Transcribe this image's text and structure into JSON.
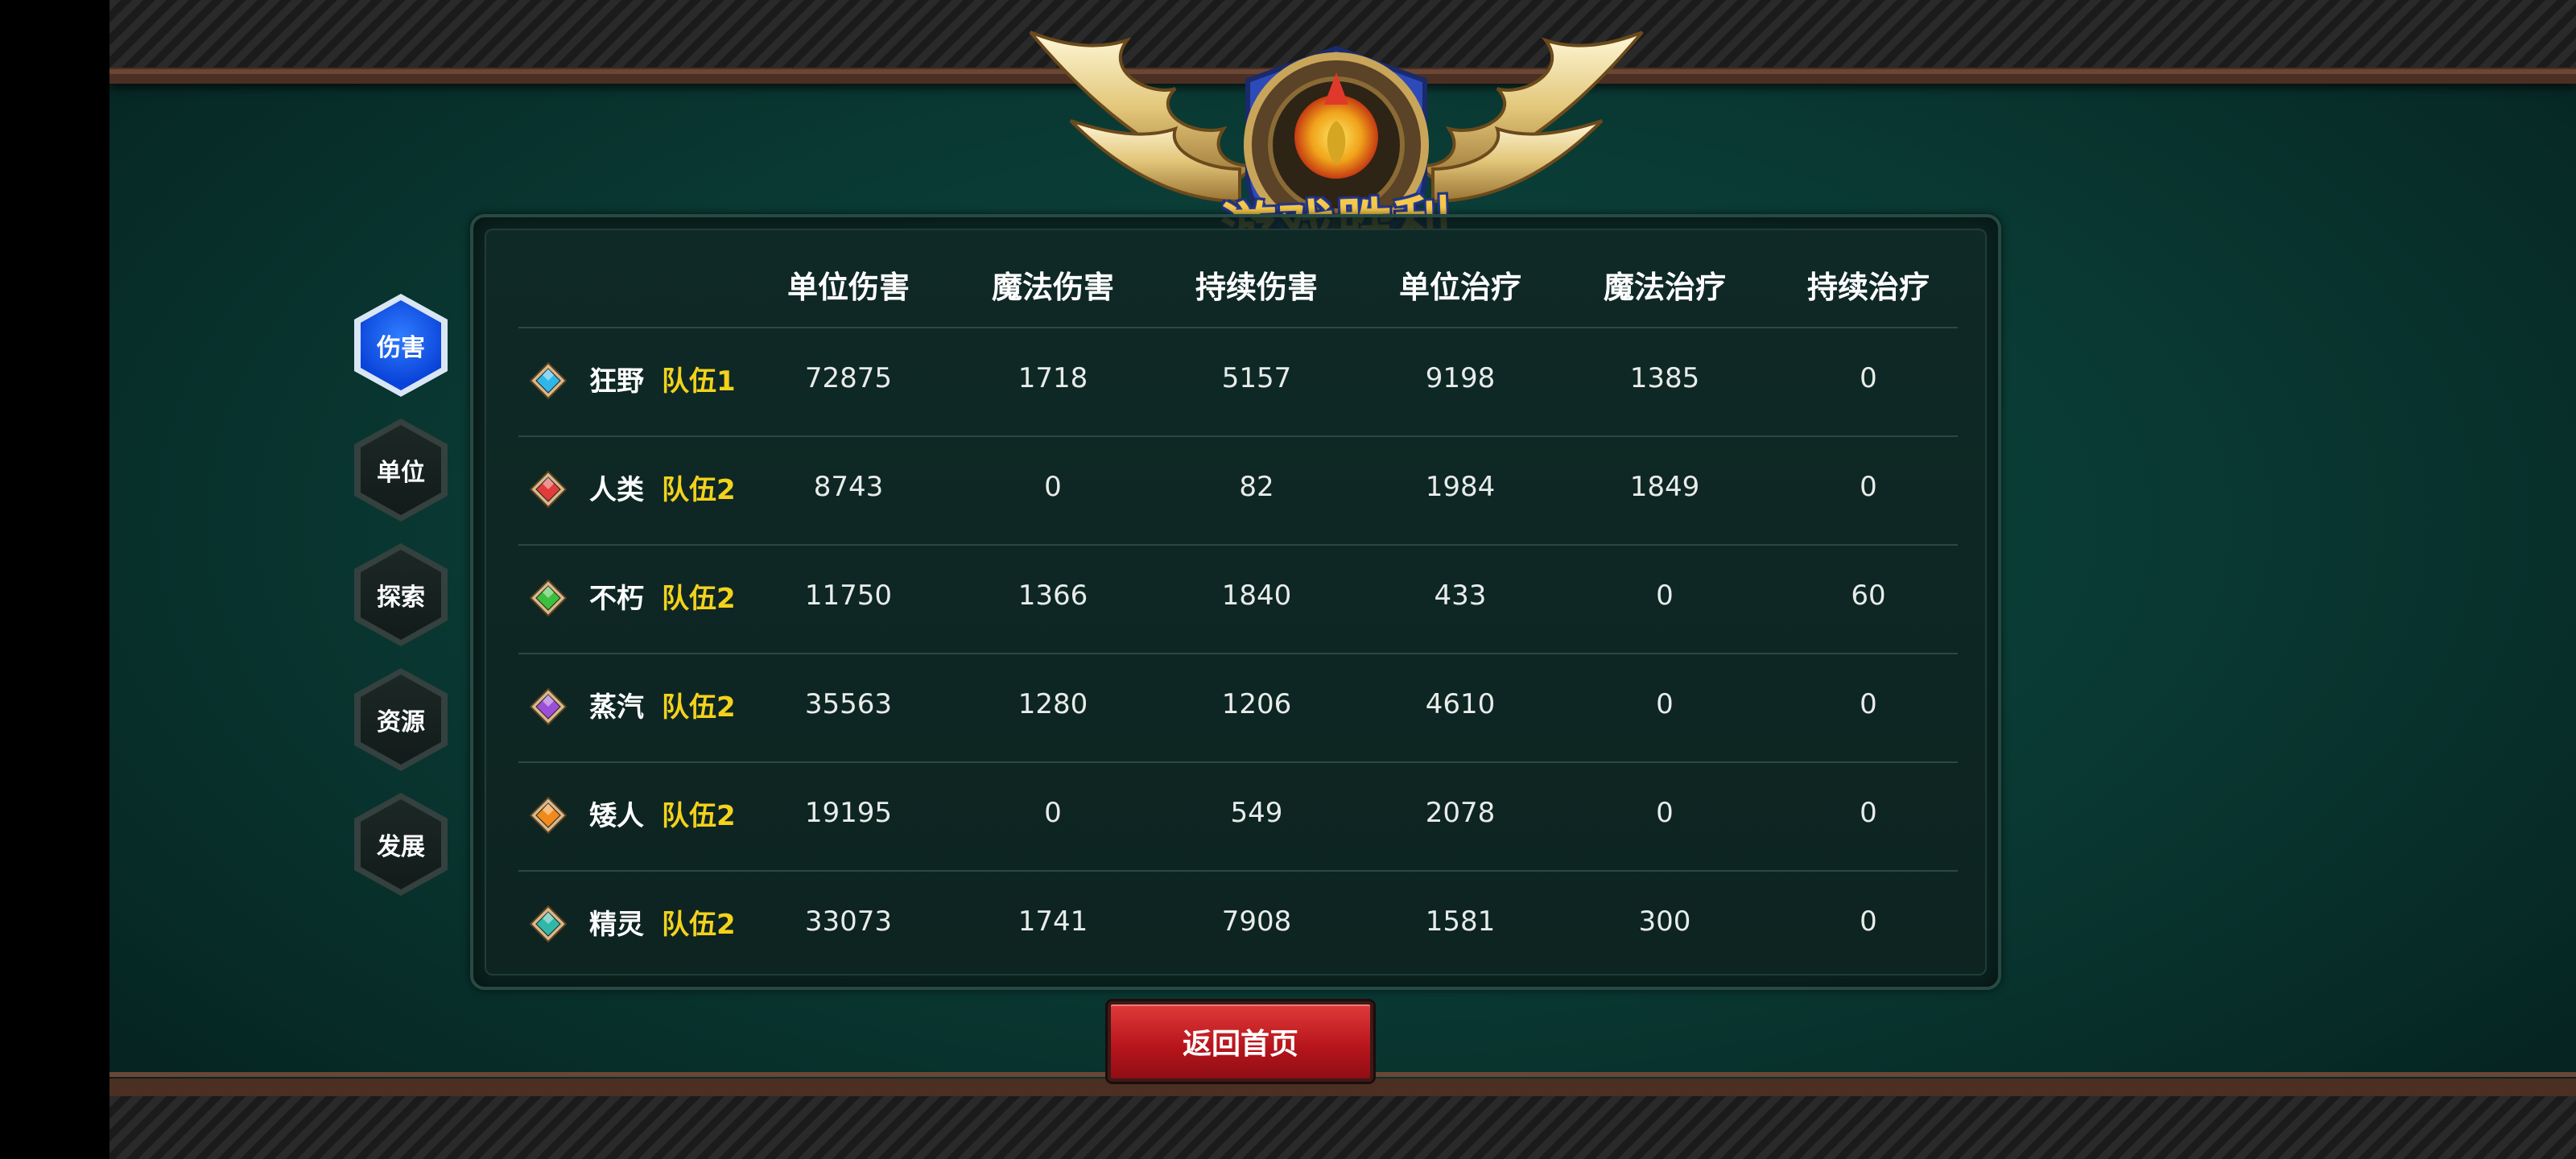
{
  "title": "游戏胜利",
  "side_nav": [
    {
      "label": "伤害",
      "active": true
    },
    {
      "label": "单位",
      "active": false
    },
    {
      "label": "探索",
      "active": false
    },
    {
      "label": "资源",
      "active": false
    },
    {
      "label": "发展",
      "active": false
    }
  ],
  "table": {
    "headers": [
      "单位伤害",
      "魔法伤害",
      "持续伤害",
      "单位治疗",
      "魔法治疗",
      "持续治疗"
    ],
    "rows": [
      {
        "race": "狂野",
        "team": "队伍1",
        "gem_color": "#2fb6e8",
        "values": [
          "72875",
          "1718",
          "5157",
          "9198",
          "1385",
          "0"
        ]
      },
      {
        "race": "人类",
        "team": "队伍2",
        "gem_color": "#e23b3b",
        "values": [
          "8743",
          "0",
          "82",
          "1984",
          "1849",
          "0"
        ]
      },
      {
        "race": "不朽",
        "team": "队伍2",
        "gem_color": "#3cbf3c",
        "values": [
          "11750",
          "1366",
          "1840",
          "433",
          "0",
          "60"
        ]
      },
      {
        "race": "蒸汽",
        "team": "队伍2",
        "gem_color": "#9b4fd8",
        "values": [
          "35563",
          "1280",
          "1206",
          "4610",
          "0",
          "0"
        ]
      },
      {
        "race": "矮人",
        "team": "队伍2",
        "gem_color": "#f08a1a",
        "values": [
          "19195",
          "0",
          "549",
          "2078",
          "0",
          "0"
        ]
      },
      {
        "race": "精灵",
        "team": "队伍2",
        "gem_color": "#2fb8a8",
        "values": [
          "33073",
          "1741",
          "7908",
          "1581",
          "300",
          "0"
        ]
      }
    ]
  },
  "home_button": "返回首页"
}
